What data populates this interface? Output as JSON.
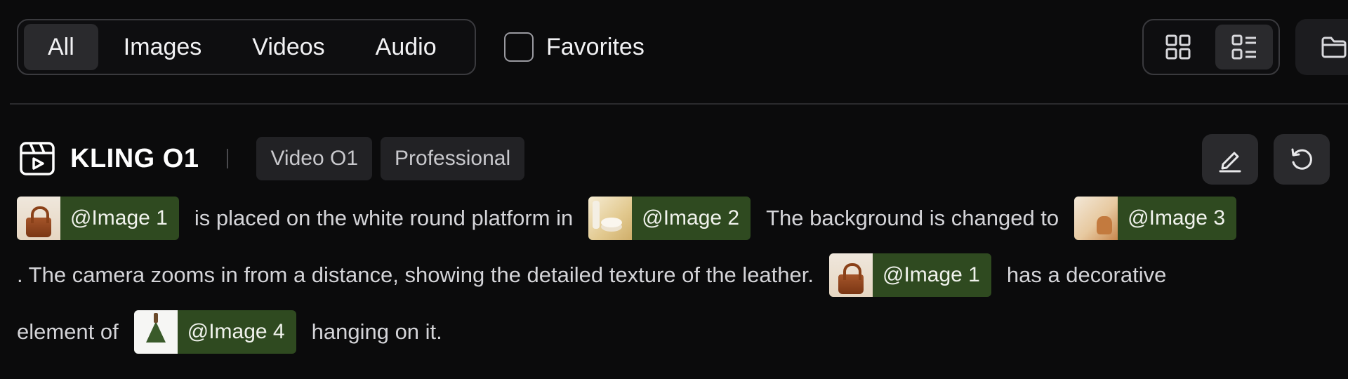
{
  "filters": {
    "tabs": [
      {
        "label": "All",
        "active": true
      },
      {
        "label": "Images",
        "active": false
      },
      {
        "label": "Videos",
        "active": false
      },
      {
        "label": "Audio",
        "active": false
      }
    ],
    "favorites_label": "Favorites",
    "favorites_checked": false
  },
  "view_toggle": {
    "grid_icon": "grid-view-icon",
    "list_icon": "list-view-icon",
    "active": "list"
  },
  "folder_icon": "folder-icon",
  "generation": {
    "model_icon": "video-clapper-icon",
    "model_name": "KLING O1",
    "tags": [
      "Video O1",
      "Professional"
    ],
    "edit_icon": "edit-pencil-icon",
    "retry_icon": "refresh-icon",
    "prompt": {
      "line1": {
        "chip1": "@Image 1",
        "text1": "is placed on the white round platform in",
        "chip2": "@Image 2",
        "text2": "The background is changed to",
        "chip3": "@Image 3"
      },
      "line2": {
        "text1": ". The camera zooms in from a distance, showing the detailed texture of the leather.",
        "chip1": "@Image 1",
        "text2": "has a decorative"
      },
      "line3": {
        "text1": "element of",
        "chip1": "@Image 4",
        "text2": "hanging on it."
      }
    }
  },
  "colors": {
    "background": "#0b0b0c",
    "chip_green": "#2f4a20",
    "tab_active": "#2a2a2d",
    "tag_bg": "#222225"
  }
}
